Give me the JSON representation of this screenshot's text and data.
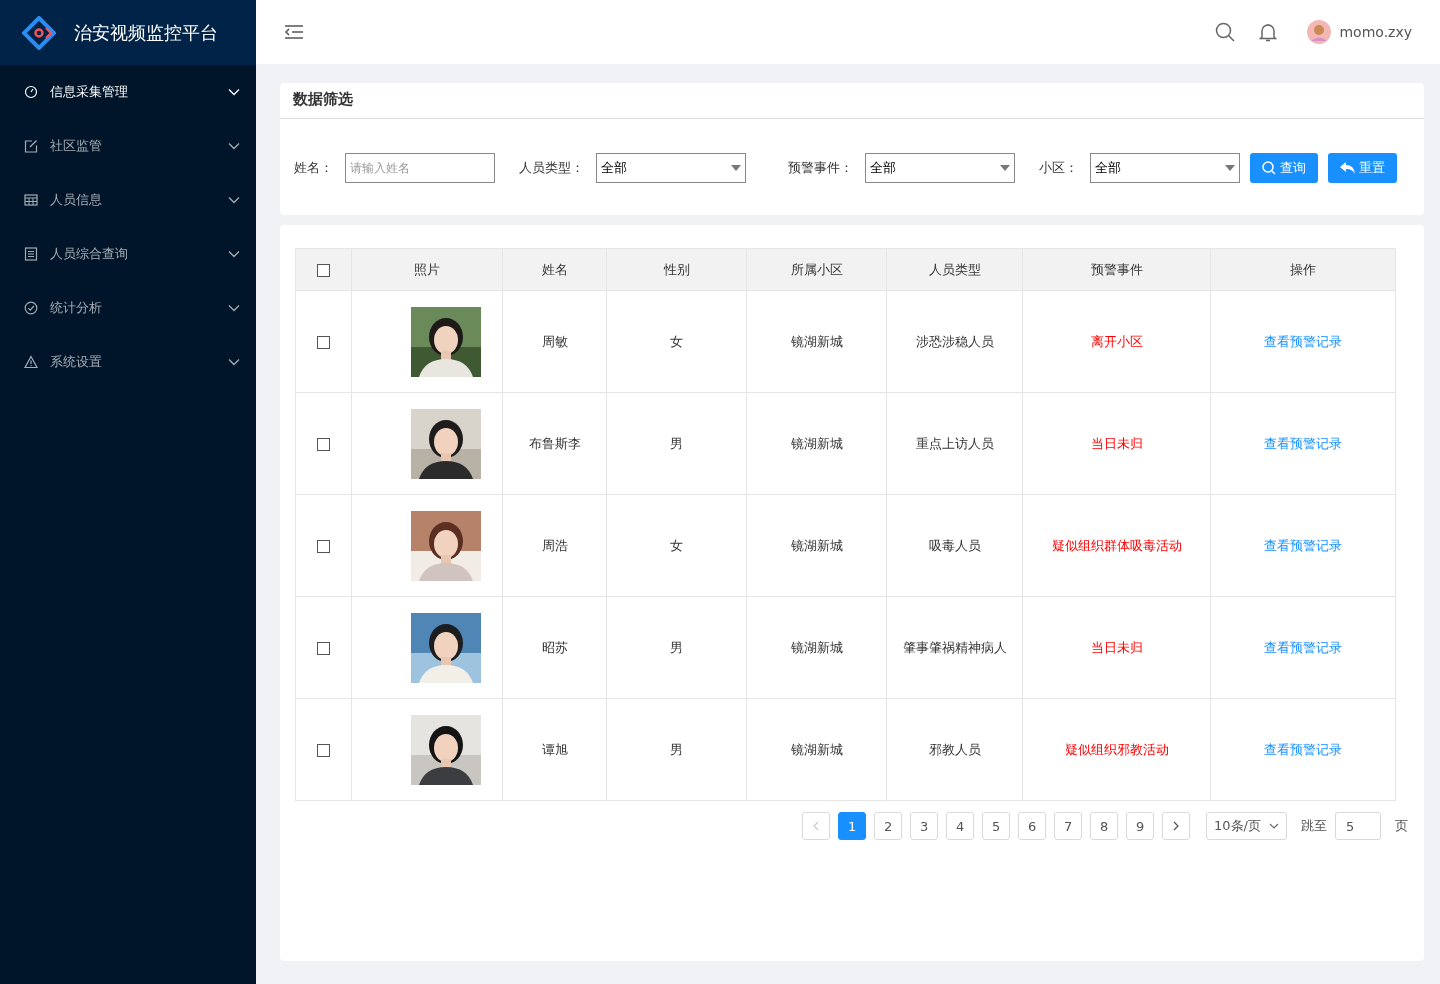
{
  "app": {
    "title": "治安视频监控平台"
  },
  "sidebar": {
    "items": [
      {
        "label": "信息采集管理",
        "selected": true
      },
      {
        "label": "社区监管",
        "selected": false
      },
      {
        "label": "人员信息",
        "selected": false
      },
      {
        "label": "人员综合查询",
        "selected": false
      },
      {
        "label": "统计分析",
        "selected": false
      },
      {
        "label": "系统设置",
        "selected": false
      }
    ]
  },
  "header": {
    "user": "momo.zxy"
  },
  "filter": {
    "title": "数据筛选",
    "fields": [
      {
        "kind": "input",
        "label": "姓名：",
        "placeholder": "请输入姓名"
      },
      {
        "kind": "select",
        "label": "人员类型：",
        "value": "全部"
      },
      {
        "kind": "select",
        "label": "预警事件：",
        "value": "全部"
      },
      {
        "kind": "select",
        "label": "小区：",
        "value": "全部"
      }
    ],
    "buttons": [
      {
        "kind": "search",
        "label": "查询"
      },
      {
        "kind": "reset",
        "label": "重置"
      }
    ]
  },
  "table": {
    "select_all_checked": false,
    "columns": [
      "照片",
      "姓名",
      "性别",
      "所属小区",
      "人员类型",
      "预警事件",
      "操作"
    ],
    "rows": [
      {
        "checked": false,
        "name": "周敏",
        "gender": "女",
        "community": "镜湖新城",
        "type": "涉恐涉稳人员",
        "event": "离开小区",
        "action": "查看预警记录"
      },
      {
        "checked": false,
        "name": "布鲁斯李",
        "gender": "男",
        "community": "镜湖新城",
        "type": "重点上访人员",
        "event": "当日未归",
        "action": "查看预警记录"
      },
      {
        "checked": false,
        "name": "周浩",
        "gender": "女",
        "community": "镜湖新城",
        "type": "吸毒人员",
        "event": "疑似组织群体吸毒活动",
        "action": "查看预警记录"
      },
      {
        "checked": false,
        "name": "昭苏",
        "gender": "男",
        "community": "镜湖新城",
        "type": "肇事肇祸精神病人",
        "event": "当日未归",
        "action": "查看预警记录"
      },
      {
        "checked": false,
        "name": "谭旭",
        "gender": "男",
        "community": "镜湖新城",
        "type": "邪教人员",
        "event": "疑似组织邪教活动",
        "action": "查看预警记录"
      }
    ]
  },
  "pagination": {
    "prev_disabled": true,
    "pages": [
      {
        "label": "1",
        "selected": true
      },
      {
        "label": "2",
        "selected": false
      },
      {
        "label": "3",
        "selected": false
      },
      {
        "label": "4",
        "selected": false
      },
      {
        "label": "5",
        "selected": false
      },
      {
        "label": "6",
        "selected": false
      },
      {
        "label": "7",
        "selected": false
      },
      {
        "label": "8",
        "selected": false
      },
      {
        "label": "9",
        "selected": false
      }
    ],
    "page_size": "10条/页",
    "jump_label": "跳至",
    "jump_value": "5",
    "page_unit": "页"
  }
}
